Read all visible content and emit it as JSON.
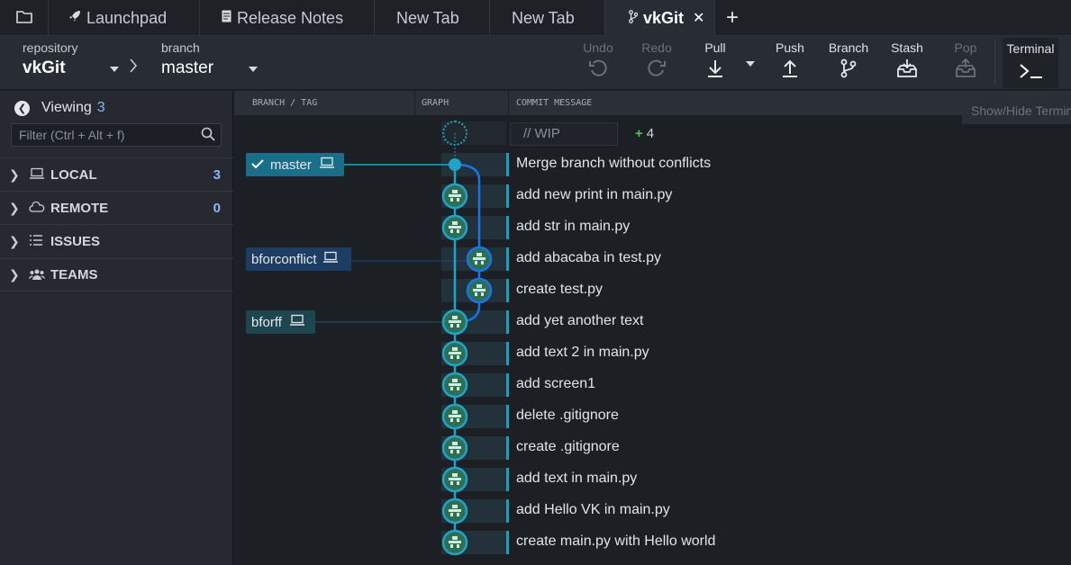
{
  "tabs": [
    {
      "label": "",
      "icon": "folder-icon"
    },
    {
      "label": "Launchpad",
      "icon": "rocket-icon"
    },
    {
      "label": "Release Notes",
      "icon": "document-icon"
    },
    {
      "label": "New Tab"
    },
    {
      "label": "New Tab"
    },
    {
      "label": "vkGit",
      "icon": "branch-icon",
      "active": true,
      "close": "✕"
    }
  ],
  "add_tab": "+",
  "toolbar": {
    "repository_caption": "repository",
    "repository_name": "vkGit",
    "branch_caption": "branch",
    "branch_name": "master",
    "undo": "Undo",
    "redo": "Redo",
    "pull": "Pull",
    "push": "Push",
    "branch": "Branch",
    "stash": "Stash",
    "pop": "Pop",
    "terminal": "Terminal"
  },
  "tooltip": "Show/Hide Terminal",
  "sidebar": {
    "viewing_label": "Viewing",
    "viewing_count": "3",
    "filter_placeholder": "Filter (Ctrl + Alt + f)",
    "sections": [
      {
        "title": "LOCAL",
        "count": "3",
        "icon": "laptop-icon"
      },
      {
        "title": "REMOTE",
        "count": "0",
        "icon": "cloud-icon"
      },
      {
        "title": "ISSUES",
        "count": "",
        "icon": "list-icon"
      },
      {
        "title": "TEAMS",
        "count": "",
        "icon": "people-icon"
      }
    ]
  },
  "columns": {
    "branch_tag": "BRANCH / TAG",
    "graph": "GRAPH",
    "commit_message": "COMMIT MESSAGE"
  },
  "wip": {
    "label": "// WIP",
    "count": "4"
  },
  "branches": [
    {
      "name": "master",
      "checked": true
    },
    {
      "name": "bforconflict"
    },
    {
      "name": "bforff"
    }
  ],
  "commits": [
    "Merge branch without conflicts",
    "add new print in main.py",
    "add str in main.py",
    "add abacaba in test.py",
    "create test.py",
    "add yet another text",
    "add text 2 in main.py",
    "add screen1",
    "delete .gitignore",
    "create .gitignore",
    "add text in main.py",
    "add Hello VK in main.py",
    "create main.py with Hello world"
  ],
  "colors": {
    "lane_main": "#1fa3c8",
    "lane_branch": "#1a73e8",
    "accent_count": "#8eb3ff",
    "wip_plus": "#4cc35a"
  }
}
